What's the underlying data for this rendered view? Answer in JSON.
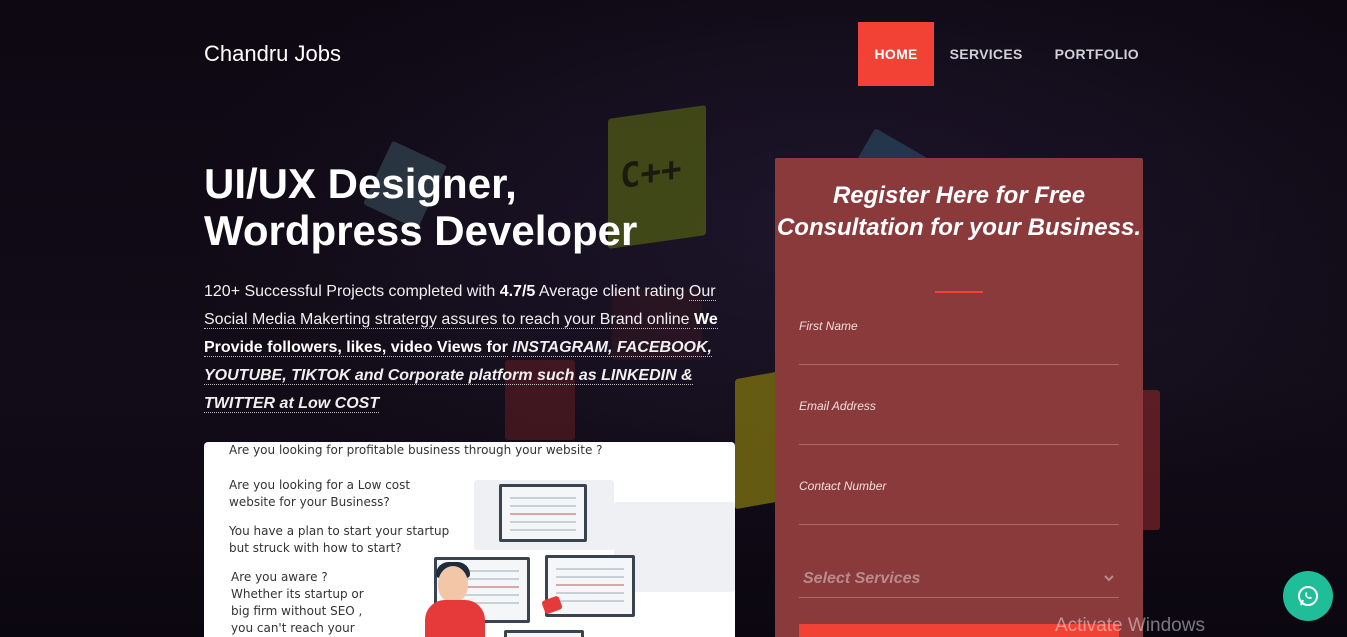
{
  "header": {
    "brand": "Chandru Jobs",
    "nav": [
      {
        "label": "HOME",
        "active": true
      },
      {
        "label": "SERVICES",
        "active": false
      },
      {
        "label": "PORTFOLIO",
        "active": false
      }
    ]
  },
  "hero": {
    "title_line1": "UI/UX Designer,",
    "title_line2": "Wordpress Developer",
    "desc": {
      "part1": "120+ Successful Projects completed with ",
      "rating": "4.7/5",
      "part2": " Average client rating ",
      "part3": "Our Social Media Makerting stratergy assures to reach your Brand online",
      "part4_bold": "We Provide followers, likes, video Views for",
      "part5_bi": "INSTAGRAM, FACEBOOK, YOUTUBE, TIKTOK and Corporate platform such as LINKEDIN & TWITTER at Low COST"
    }
  },
  "promo": {
    "q1": "Are you looking for profitable business through your website ?",
    "q2": "Are you looking for a Low cost website for your Business?",
    "q3": "You have a plan to start your startup but struck with how to start?",
    "q4": "Are you aware ? Whether its startup or big firm without SEO , you can't reach your"
  },
  "form": {
    "title_pre": "Register Here for ",
    "title_bold": "Free Consultation",
    "title_post": " for your Business.",
    "fields": {
      "first_name": "First Name",
      "email": "Email Address",
      "contact": "Contact Number"
    },
    "select_placeholder": "Select Services"
  },
  "overlay": {
    "watermark": "Activate Windows"
  },
  "colors": {
    "accent": "#f24236",
    "form_bg": "#8b3a3c",
    "whatsapp": "#1fbe98"
  }
}
